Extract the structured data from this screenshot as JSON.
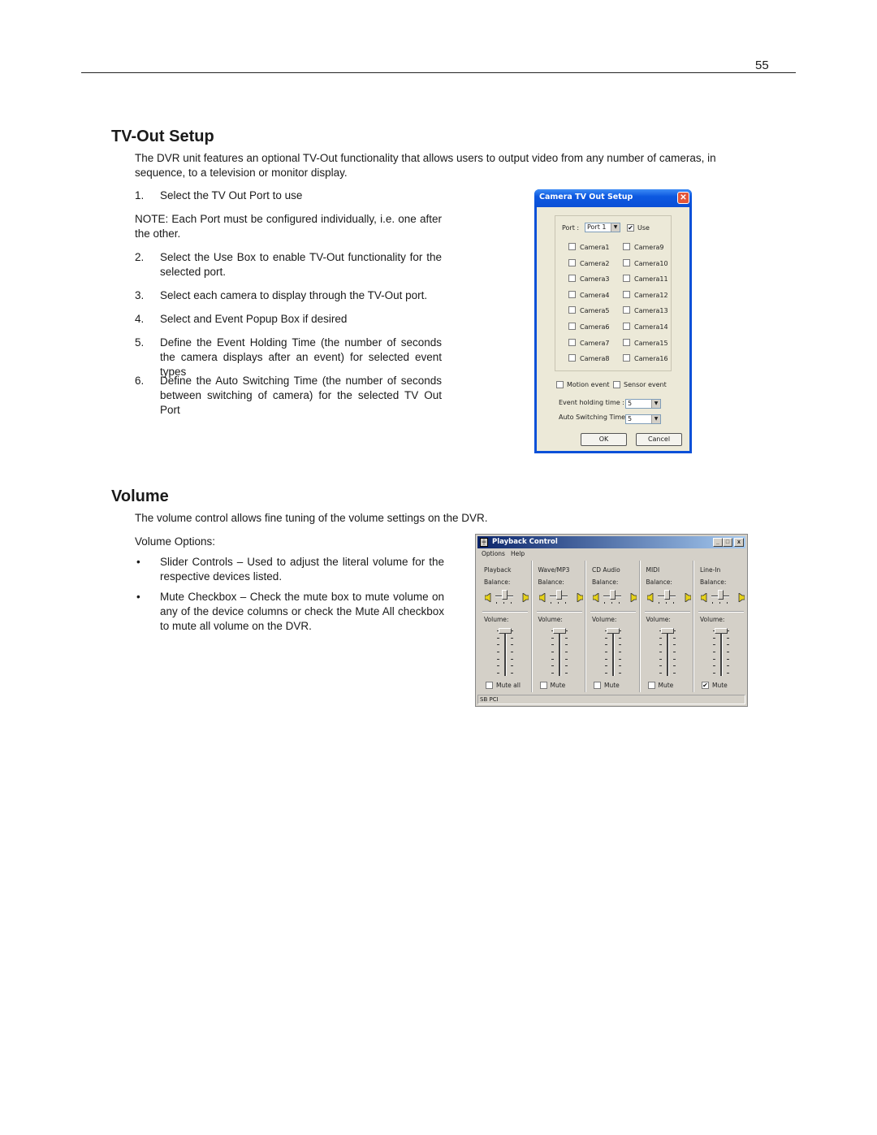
{
  "page": {
    "number": "55"
  },
  "tvout": {
    "heading": "TV-Out Setup",
    "intro": "The DVR unit features an optional TV-Out functionality that allows users to output video from any number of cameras, in sequence, to a television or monitor display.",
    "steps": [
      {
        "n": "1.",
        "text": "Select the TV Out Port  to use"
      },
      {
        "n": "2.",
        "text": "Select the Use Box to enable TV-Out functionality for the selected port."
      },
      {
        "n": "3.",
        "text": "Select each camera to display through the TV-Out port."
      },
      {
        "n": "4.",
        "text": "Select and Event Popup Box if desired"
      },
      {
        "n": "5.",
        "text": "Define the Event Holding Time (the number of seconds the camera displays after an event) for selected event types"
      },
      {
        "n": "6.",
        "text": "Define the Auto Switching Time (the number of seconds between switching of camera) for the selected TV Out Port"
      }
    ],
    "note": "NOTE:  Each Port must be configured individually, i.e. one after the other.",
    "dialog": {
      "title": "Camera TV Out Setup",
      "close_glyph": "✕",
      "port_label": "Port :",
      "port_value": "Port 1",
      "use_label": "Use",
      "use_checked": true,
      "cameras_left": [
        "Camera1",
        "Camera2",
        "Camera3",
        "Camera4",
        "Camera5",
        "Camera6",
        "Camera7",
        "Camera8"
      ],
      "cameras_right": [
        "Camera9",
        "Camera10",
        "Camera11",
        "Camera12",
        "Camera13",
        "Camera14",
        "Camera15",
        "Camera16"
      ],
      "motion_event": "Motion event",
      "sensor_event": "Sensor event",
      "event_holding_label": "Event holding time :",
      "event_holding_value": "5",
      "auto_switching_label": "Auto Switching Time :",
      "auto_switching_value": "5",
      "ok": "OK",
      "cancel": "Cancel",
      "dropdown_glyph": "▼",
      "check_glyph": "✔"
    }
  },
  "volume": {
    "heading": "Volume",
    "intro": "The volume control allows fine tuning of the volume settings on the DVR.",
    "options_label": "Volume Options:",
    "bullets": [
      {
        "text": "Slider Controls – Used to adjust the literal volume for the respective devices listed."
      },
      {
        "text": "Mute Checkbox – Check the mute box to mute volume on any of the device columns or check the Mute All checkbox to mute all volume on the DVR."
      }
    ],
    "bullet_glyph": "•",
    "window": {
      "title": "Playback Control",
      "app_icon_glyph": "╪",
      "minimize_glyph": "_",
      "maximize_glyph": "□",
      "close_glyph": "x",
      "menu": [
        "Options",
        "Help"
      ],
      "balance_label": "Balance:",
      "volume_label": "Volume:",
      "columns": [
        {
          "name": "Playback",
          "mute_label": "Mute all",
          "muted": false,
          "volume": 1.0,
          "balance": 0.5
        },
        {
          "name": "Wave/MP3",
          "mute_label": "Mute",
          "muted": false,
          "volume": 1.0,
          "balance": 0.5
        },
        {
          "name": "CD Audio",
          "mute_label": "Mute",
          "muted": false,
          "volume": 1.0,
          "balance": 0.5
        },
        {
          "name": "MIDI",
          "mute_label": "Mute",
          "muted": false,
          "volume": 1.0,
          "balance": 0.5
        },
        {
          "name": "Line-In",
          "mute_label": "Mute",
          "muted": true,
          "volume": 1.0,
          "balance": 0.5
        }
      ],
      "status": "SB PCI",
      "check_glyph": "✔"
    }
  }
}
